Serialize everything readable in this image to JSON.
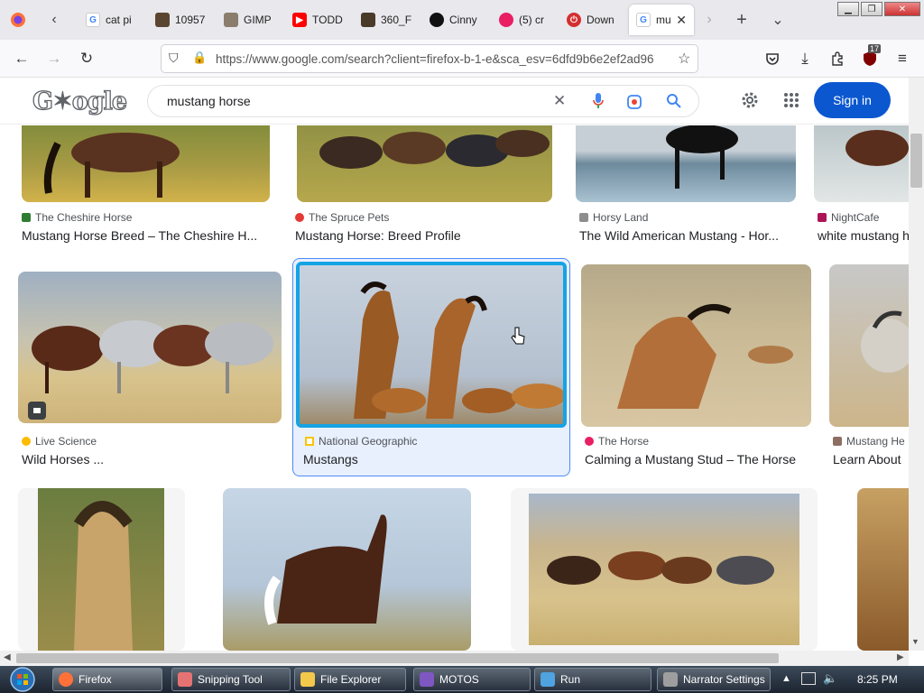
{
  "browser": {
    "tabs": [
      {
        "label": "cat pi",
        "favicon": "google-icon"
      },
      {
        "label": "10957",
        "favicon": "image-thumb-icon"
      },
      {
        "label": "GIMP",
        "favicon": "gimp-icon"
      },
      {
        "label": "TODD",
        "favicon": "youtube-icon"
      },
      {
        "label": "360_F",
        "favicon": "image-thumb-icon"
      },
      {
        "label": "Cinny",
        "favicon": "cinny-icon"
      },
      {
        "label": "(5) cr",
        "favicon": "notification-icon"
      },
      {
        "label": "Down",
        "favicon": "download-site-icon"
      },
      {
        "label": "mu",
        "favicon": "google-icon",
        "active": true
      }
    ],
    "url": "https://www.google.com/search?client=firefox-b-1-e&sca_esv=6dfd9b6e2ef2ad96",
    "extension_badge": "17"
  },
  "google": {
    "search_query": "mustang horse",
    "sign_in_label": "Sign in"
  },
  "results": {
    "row1": [
      {
        "source": "The Cheshire Horse",
        "title": "Mustang Horse Breed – The Cheshire H..."
      },
      {
        "source": "The Spruce Pets",
        "title": "Mustang Horse: Breed Profile"
      },
      {
        "source": "Horsy Land",
        "title": "The Wild American Mustang - Hor..."
      },
      {
        "source": "NightCafe",
        "title": "white mustang h"
      }
    ],
    "row2": [
      {
        "source": "Live Science",
        "title": "Wild Horses ..."
      },
      {
        "source": "National Geographic",
        "title": "Mustangs"
      },
      {
        "source": "The Horse",
        "title": "Calming a Mustang Stud – The Horse"
      },
      {
        "source": "Mustang He",
        "title": "Learn About"
      }
    ]
  },
  "taskbar": {
    "items": [
      {
        "label": "Firefox"
      },
      {
        "label": "Snipping Tool"
      },
      {
        "label": "File Explorer"
      },
      {
        "label": "MOTOS"
      },
      {
        "label": "Run"
      },
      {
        "label": "Narrator Settings"
      }
    ],
    "clock": "8:25 PM"
  },
  "colors": {
    "accent_blue": "#0b57d0",
    "selection_border": "#4c8bf5",
    "selection_bg": "#e8f0fe"
  }
}
